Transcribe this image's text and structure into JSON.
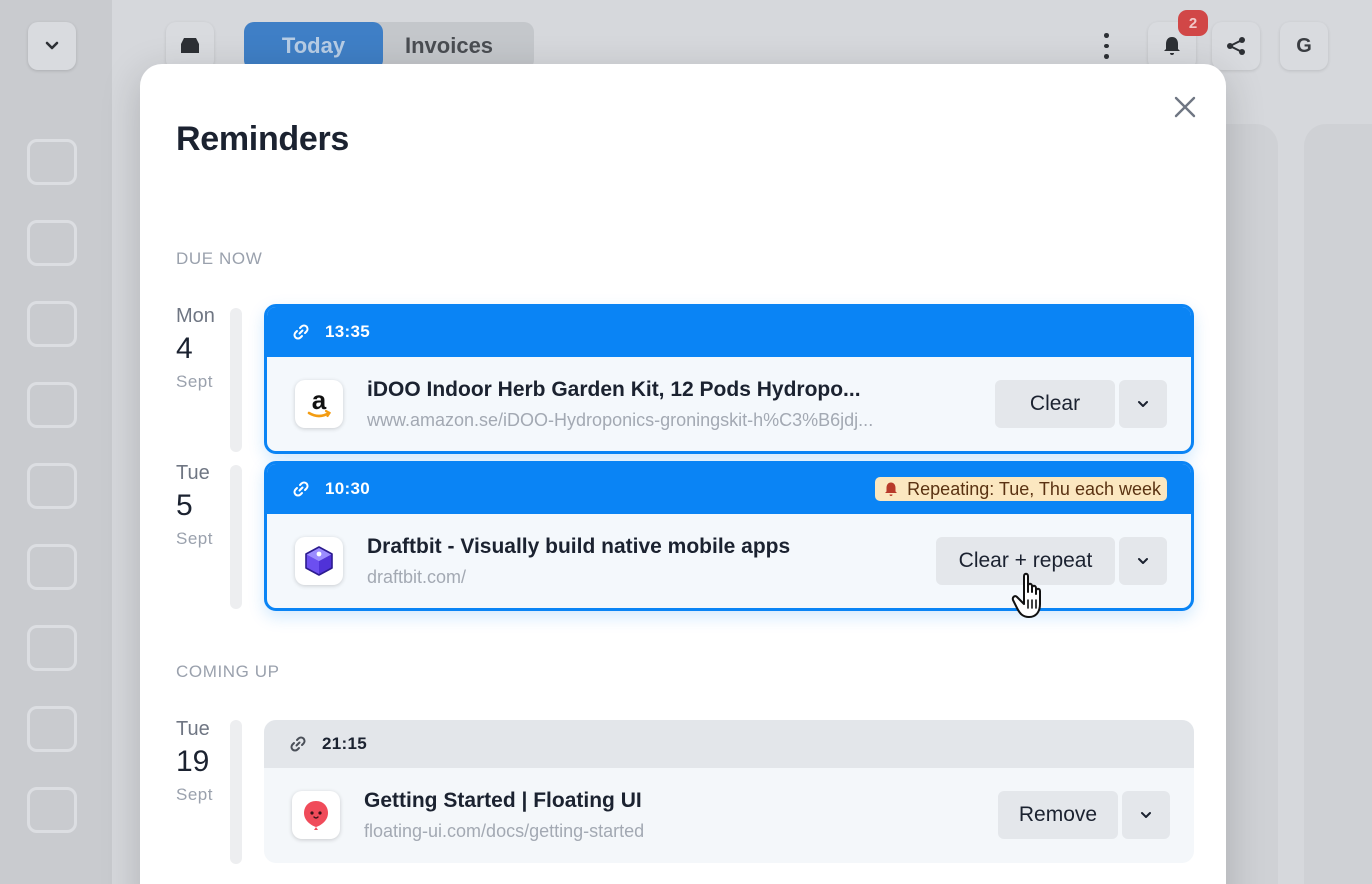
{
  "background": {
    "tabs": [
      {
        "label": "Today",
        "active": true
      },
      {
        "label": "Invoices",
        "active": false
      }
    ],
    "notification_count": "2",
    "avatar_initial": "G"
  },
  "modal": {
    "title": "Reminders",
    "sections": {
      "due_now": "DUE NOW",
      "coming_up": "COMING UP"
    },
    "groups": [
      {
        "date": {
          "dow": "Mon",
          "day": "4",
          "month": "Sept"
        },
        "reminder": {
          "time": "13:35",
          "icon": "amazon-favicon",
          "title": "iDOO Indoor Herb Garden Kit, 12 Pods Hydropo...",
          "url": "www.amazon.se/iDOO-Hydroponics-groningskit-h%C3%B6jdj...",
          "action": "Clear"
        }
      },
      {
        "date": {
          "dow": "Tue",
          "day": "5",
          "month": "Sept"
        },
        "reminder": {
          "time": "10:30",
          "repeat": "Repeating: Tue, Thu each week",
          "icon": "draftbit-favicon",
          "title": "Draftbit - Visually build native mobile apps",
          "url": "draftbit.com/",
          "action": "Clear + repeat"
        }
      },
      {
        "date": {
          "dow": "Tue",
          "day": "19",
          "month": "Sept"
        },
        "reminder": {
          "time": "21:15",
          "icon": "floating-ui-favicon",
          "title": "Getting Started | Floating UI",
          "url": "floating-ui.com/docs/getting-started",
          "action": "Remove"
        }
      }
    ]
  },
  "colors": {
    "accent": "#0a84f5",
    "repeat_badge_bg": "#fbe7c0",
    "title_text": "#1b2230"
  }
}
